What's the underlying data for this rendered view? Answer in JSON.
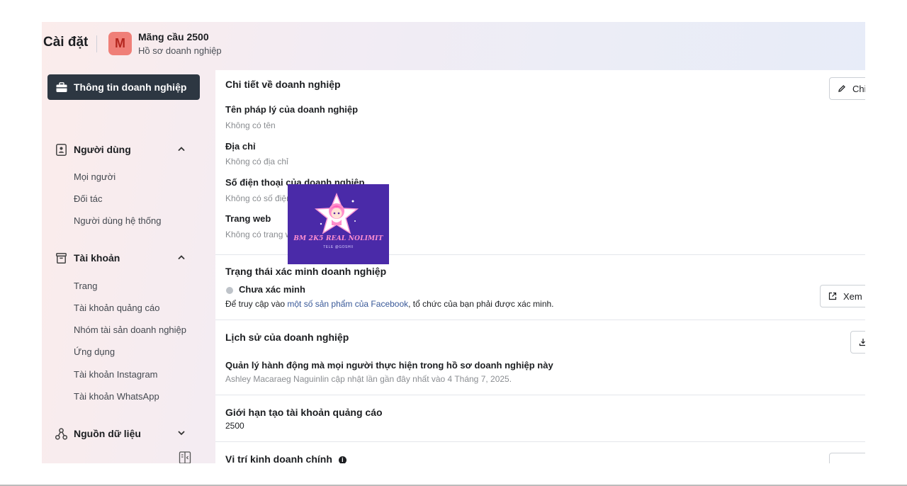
{
  "header": {
    "settings_title": "Cài đặt",
    "avatar_letter": "M",
    "business_name": "Mãng cầu 2500",
    "business_subtitle": "Hồ sơ doanh nghiệp"
  },
  "sidebar": {
    "active_item": "Thông tin doanh nghiệp",
    "sections": [
      {
        "label": "Người dùng",
        "expanded": true,
        "items": [
          "Mọi người",
          "Đối tác",
          "Người dùng hệ thống"
        ]
      },
      {
        "label": "Tài khoản",
        "expanded": true,
        "items": [
          "Trang",
          "Tài khoản quảng cáo",
          "Nhóm tài sản doanh nghiệp",
          "Ứng dụng",
          "Tài khoản Instagram",
          "Tài khoản WhatsApp"
        ]
      },
      {
        "label": "Nguồn dữ liệu",
        "expanded": false,
        "items": []
      }
    ]
  },
  "details": {
    "title": "Chi tiết về doanh nghiệp",
    "edit_button": "Chi",
    "fields": [
      {
        "label": "Tên pháp lý của doanh nghiệp",
        "value": "Không có tên"
      },
      {
        "label": "Địa chỉ",
        "value": "Không có địa chỉ"
      },
      {
        "label": "Số điện thoại của doanh nghiệp",
        "value": "Không có số điện thoại"
      },
      {
        "label": "Trang web",
        "value": "Không có trang web"
      }
    ]
  },
  "verification": {
    "title": "Trạng thái xác minh doanh nghiệp",
    "status": "Chưa xác minh",
    "desc_prefix": "Để truy cập vào ",
    "desc_link": "một số sản phẩm của Facebook",
    "desc_suffix": ", tổ chức của bạn phải được xác minh.",
    "view_button": "Xem"
  },
  "history": {
    "title": "Lịch sử của doanh nghiệp",
    "subtitle": "Quản lý hành động mà mọi người thực hiện trong hồ sơ doanh nghiệp này",
    "updated": "Ashley Macaraeg Naguinlin cập nhật lần gần đây nhất vào 4 Tháng 7, 2025."
  },
  "ad_limit": {
    "title": "Giới hạn tạo tài khoản quảng cáo",
    "value": "2500"
  },
  "location": {
    "title": "Vị trí kinh doanh chính"
  },
  "watermark": {
    "title": "BM 2K5 REAL NOLIMIT",
    "subtitle": "TELE @GOSHII"
  },
  "colors": {
    "sidebar_active_bg": "#2d3742",
    "avatar_bg": "#ef7f78",
    "link": "#385898",
    "watermark_bg": "#4a2aa8"
  }
}
